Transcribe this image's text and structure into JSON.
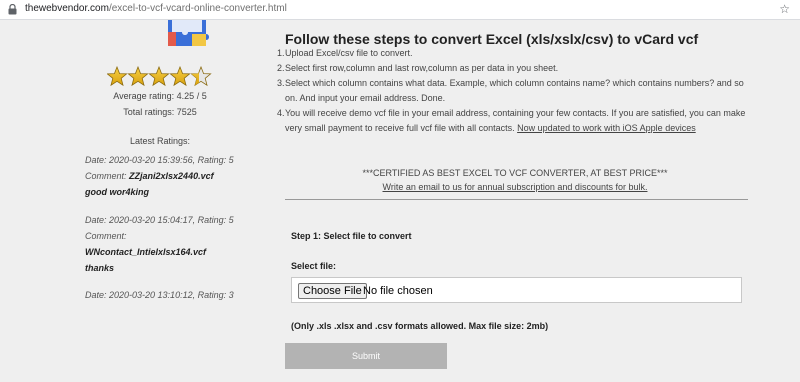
{
  "browser": {
    "url_host": "thewebvendor.com",
    "url_path": "/excel-to-vcf-vcard-online-converter.html"
  },
  "sidebar": {
    "stars": 4.25,
    "average_rating": "Average rating: 4.25 / 5",
    "total_ratings": "Total ratings: 7525",
    "latest_title": "Latest Ratings:",
    "ratings": [
      {
        "meta": "Date: 2020-03-20 15:39:56, Rating: 5",
        "comment_label": "Comment:",
        "file": "ZZjani2xlsx2440.vcf",
        "text": "good wor4king"
      },
      {
        "meta": "Date: 2020-03-20 15:04:17, Rating: 5",
        "comment_label": "Comment:",
        "file": "WNcontact_Intielxlsx164.vcf",
        "text": "thanks"
      },
      {
        "meta": "Date: 2020-03-20 13:10:12, Rating: 3"
      }
    ]
  },
  "main": {
    "title": "Follow these steps to convert Excel (xls/xslx/csv) to vCard vcf",
    "steps": [
      {
        "num": "1.",
        "text": "Upload Excel/csv file to convert."
      },
      {
        "num": "2.",
        "text": "Select first row,column and last row,column as per data in you sheet."
      },
      {
        "num": "3.",
        "text": "Select which column contains what data. Example, which column contains name? which contains numbers? and so on. And input your email address. Done."
      },
      {
        "num": "4.",
        "text": "You will receive demo vcf file in your email address, containing your few contacts. If you are satisfied, you can make very small payment to receive full vcf file with all contacts.",
        "link": "Now updated to work with iOS Apple devices"
      }
    ],
    "certified": "***CERTIFIED AS BEST EXCEL TO VCF CONVERTER, AT BEST PRICE***",
    "bulk_link": "Write an email to us for annual subscription and discounts for bulk.",
    "step1_title": "Step 1: Select file to convert",
    "select_file_label": "Select file:",
    "choose_file": "Choose File",
    "no_file": "No file chosen",
    "formats_note": "(Only .xls .xlsx and .csv formats allowed. Max file size: 2mb)",
    "submit": "Submit"
  }
}
